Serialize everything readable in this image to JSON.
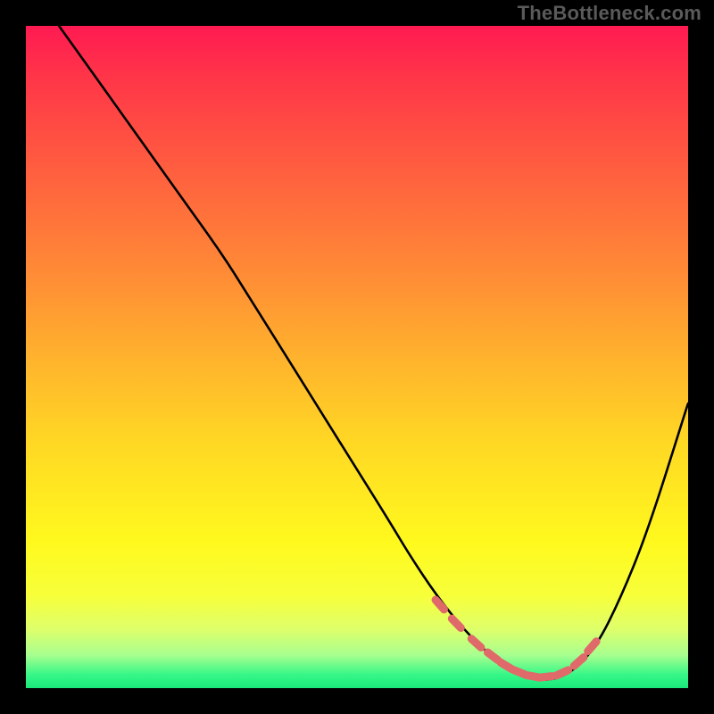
{
  "watermark": "TheBottleneck.com",
  "chart_data": {
    "type": "line",
    "title": "",
    "xlabel": "",
    "ylabel": "",
    "xlim": [
      0,
      100
    ],
    "ylim": [
      0,
      100
    ],
    "grid": false,
    "legend": false,
    "series": [
      {
        "name": "bottleneck-curve",
        "color": "#000000",
        "x": [
          5,
          10,
          15,
          20,
          25,
          30,
          35,
          40,
          45,
          50,
          55,
          58,
          62,
          66,
          70,
          74,
          78,
          82,
          86,
          90,
          94,
          100
        ],
        "y": [
          100,
          93,
          86,
          79,
          72,
          65,
          57,
          49,
          41,
          33,
          25,
          20,
          14,
          9,
          5,
          2,
          1,
          2,
          6,
          14,
          24,
          43
        ]
      }
    ],
    "markers": {
      "name": "highlighted-range",
      "color": "#e06a6a",
      "shape": "rounded-dash",
      "points_x": [
        62.5,
        65,
        68,
        70.5,
        72.5,
        74.5,
        76.5,
        78.5,
        81,
        83.5,
        85.5
      ],
      "points_y": [
        12.6,
        9.8,
        6.8,
        4.8,
        3.4,
        2.4,
        1.8,
        1.7,
        2.3,
        4.0,
        6.3
      ]
    }
  }
}
